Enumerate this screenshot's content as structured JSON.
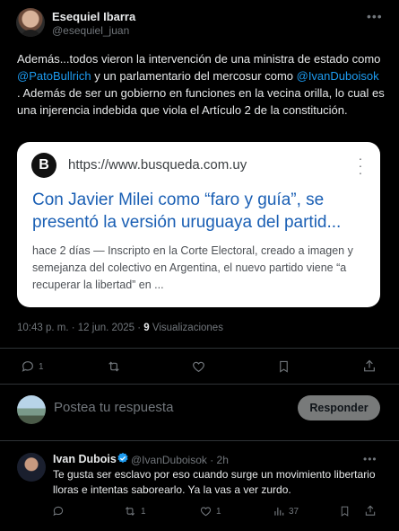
{
  "post": {
    "author_name": "Esequiel Ibarra",
    "author_handle": "@esequiel_juan",
    "body_parts": {
      "p1": "Además...todos vieron la intervención de una ministra de estado como ",
      "mention1": "@PatoBullrich",
      "p2": " y un parlamentario del mercosur como ",
      "mention2": "@IvanDuboisok",
      "p3": " . Además de ser un gobierno en funciones en la vecina orilla, lo cual es una injerencia indebida que viola el Artículo 2 de la constitución."
    },
    "card": {
      "logo_letter": "B",
      "url": "https://www.busqueda.com.uy",
      "title_line1": "Con Javier Milei como “faro y guía”, se",
      "title_line2": "presentó la versión uruguaya del partid...",
      "description": "hace 2 días — Inscripto en la Corte Electoral, creado a imagen y semejanza del colectivo en Argentina, el nuevo partido viene “a recuperar la libertad” en ..."
    },
    "time": "10:43 p. m. · 12 jun. 2025 · ",
    "views_count": "9",
    "views_label": " Visualizaciones",
    "actions": {
      "reply_count": "1",
      "repost_count": "",
      "like_count": ""
    }
  },
  "compose": {
    "placeholder": "Postea tu respuesta",
    "button_label": "Responder"
  },
  "reply": {
    "author_name": "Ivan Dubois",
    "author_handle": "@IvanDuboisok · 2h",
    "text": "Te gusta ser esclavo por eso cuando surge un movimiento libertario lloras e intentas saborearlo. Ya la vas a ver zurdo.",
    "actions": {
      "reply_count": "",
      "repost_count": "1",
      "like_count": "1",
      "views_count": "37"
    }
  },
  "colors": {
    "background": "#000000",
    "text": "#e7e9ea",
    "muted": "#71767b",
    "link": "#1d9bf0",
    "card_title": "#1a5fb4",
    "divider": "#2f3336",
    "verified": "#1d9bf0"
  },
  "icons": {
    "more": "more-horizontal-icon",
    "reply": "reply-icon",
    "repost": "repost-icon",
    "like": "heart-icon",
    "bookmark": "bookmark-icon",
    "share": "share-icon",
    "views": "views-chart-icon",
    "verified": "verified-badge-icon",
    "card_more": "more-vertical-icon"
  }
}
